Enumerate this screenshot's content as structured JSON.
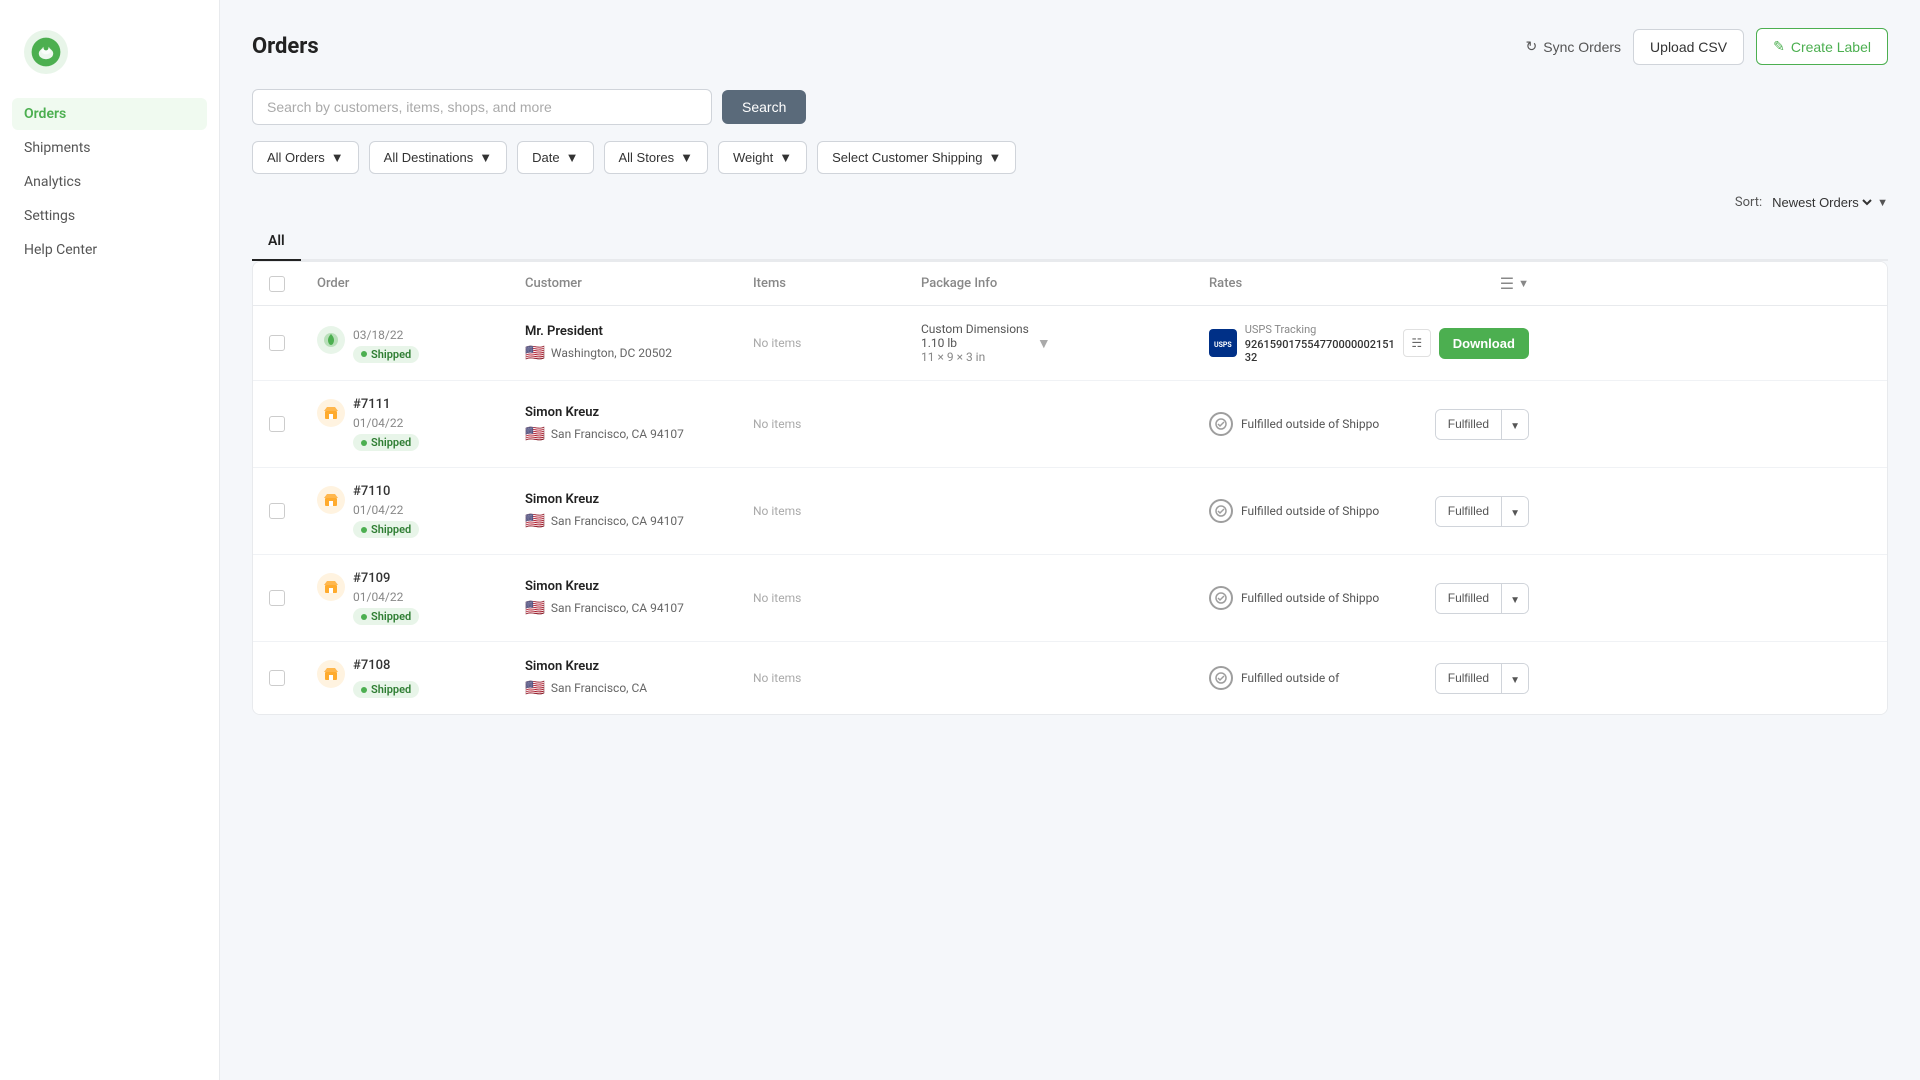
{
  "app": {
    "logo_alt": "Shippo Logo"
  },
  "sidebar": {
    "items": [
      {
        "id": "orders",
        "label": "Orders",
        "active": true
      },
      {
        "id": "shipments",
        "label": "Shipments",
        "active": false
      },
      {
        "id": "analytics",
        "label": "Analytics",
        "active": false
      },
      {
        "id": "settings",
        "label": "Settings",
        "active": false
      },
      {
        "id": "help-center",
        "label": "Help Center",
        "active": false
      }
    ]
  },
  "header": {
    "title": "Orders",
    "sync_label": "Sync Orders",
    "upload_csv_label": "Upload CSV",
    "create_label_label": "Create Label"
  },
  "search": {
    "placeholder": "Search by customers, items, shops, and more",
    "button_label": "Search"
  },
  "filters": {
    "all_orders_label": "All Orders",
    "all_destinations_label": "All Destinations",
    "date_label": "Date",
    "all_stores_label": "All Stores",
    "weight_label": "Weight",
    "select_customer_shipping_label": "Select Customer Shipping"
  },
  "sort": {
    "label": "Sort:",
    "value": "Newest Orders"
  },
  "tabs": [
    {
      "id": "all",
      "label": "All",
      "active": true
    }
  ],
  "table": {
    "columns": [
      {
        "id": "order",
        "label": "Order"
      },
      {
        "id": "customer",
        "label": "Customer"
      },
      {
        "id": "items",
        "label": "Items"
      },
      {
        "id": "package_info",
        "label": "Package Info"
      },
      {
        "id": "rates",
        "label": "Rates"
      }
    ],
    "rows": [
      {
        "id": "row-1",
        "order_number": "",
        "order_date": "03/18/22",
        "status": "Shipped",
        "icon_type": "green",
        "customer_name": "Mr. President",
        "customer_address": "Washington, DC 20502",
        "items_text": "No items",
        "package_type": "Custom Dimensions",
        "package_weight": "1.10 lb",
        "package_dims": "11 × 9 × 3 in",
        "rate_type": "download",
        "carrier": "USPS",
        "tracking_label": "USPS Tracking",
        "tracking_number": "926159017554770000002151 32",
        "download_label": "Download"
      },
      {
        "id": "row-2",
        "order_number": "#7111",
        "order_date": "01/04/22",
        "status": "Shipped",
        "icon_type": "shop",
        "customer_name": "Simon Kreuz",
        "customer_address": "San Francisco, CA 94107",
        "items_text": "No items",
        "package_type": "",
        "package_weight": "",
        "package_dims": "",
        "rate_type": "fulfilled",
        "fulfilled_text": "Fulfilled outside of Shippo",
        "fulfilled_label": "Fulfilled"
      },
      {
        "id": "row-3",
        "order_number": "#7110",
        "order_date": "01/04/22",
        "status": "Shipped",
        "icon_type": "shop",
        "customer_name": "Simon Kreuz",
        "customer_address": "San Francisco, CA 94107",
        "items_text": "No items",
        "package_type": "",
        "package_weight": "",
        "package_dims": "",
        "rate_type": "fulfilled",
        "fulfilled_text": "Fulfilled outside of Shippo",
        "fulfilled_label": "Fulfilled"
      },
      {
        "id": "row-4",
        "order_number": "#7109",
        "order_date": "01/04/22",
        "status": "Shipped",
        "icon_type": "shop",
        "customer_name": "Simon Kreuz",
        "customer_address": "San Francisco, CA 94107",
        "items_text": "No items",
        "package_type": "",
        "package_weight": "",
        "package_dims": "",
        "rate_type": "fulfilled",
        "fulfilled_text": "Fulfilled outside of Shippo",
        "fulfilled_label": "Fulfilled"
      },
      {
        "id": "row-5",
        "order_number": "#7108",
        "order_date": "",
        "status": "Shipped",
        "icon_type": "shop",
        "customer_name": "Simon Kreuz",
        "customer_address": "San Francisco, CA",
        "items_text": "No items",
        "package_type": "",
        "package_weight": "",
        "package_dims": "",
        "rate_type": "fulfilled",
        "fulfilled_text": "Fulfilled outside of",
        "fulfilled_label": "Fulfilled"
      }
    ]
  }
}
